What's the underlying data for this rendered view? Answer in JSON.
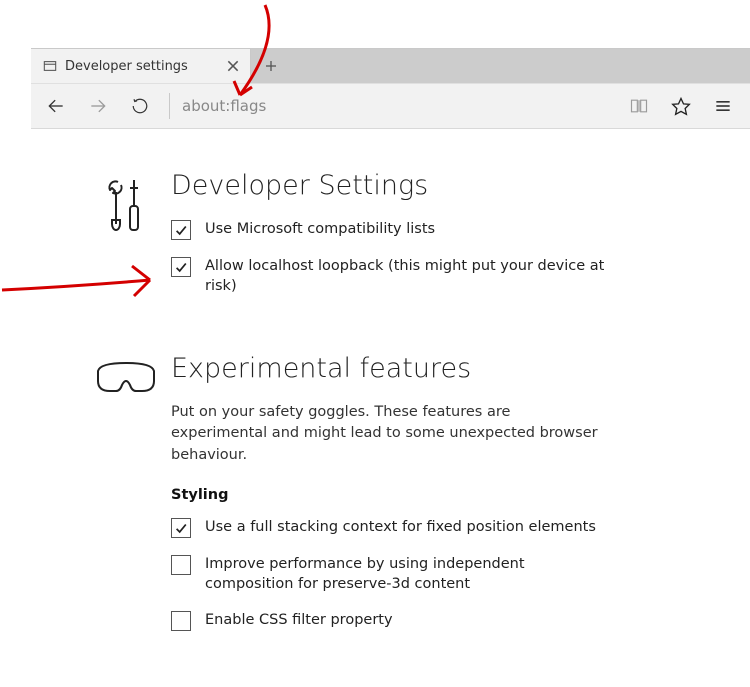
{
  "browser": {
    "tab_title": "Developer settings",
    "address_text": "about:flags"
  },
  "icons": {
    "back": "←",
    "forward": "→",
    "refresh": "↻",
    "reading": "📖",
    "star": "☆",
    "menu": "≡",
    "close": "×",
    "plus": "+"
  },
  "sections": {
    "dev": {
      "title": "Developer Settings",
      "items": [
        {
          "label": "Use Microsoft compatibility lists",
          "checked": true
        },
        {
          "label": "Allow localhost loopback (this might put your device at risk)",
          "checked": true
        }
      ]
    },
    "exp": {
      "title": "Experimental features",
      "description": "Put on your safety goggles. These features are experimental and might lead to some unexpected browser behaviour.",
      "styling_heading": "Styling",
      "styling_items": [
        {
          "label": "Use a full stacking context for fixed position elements",
          "checked": true
        },
        {
          "label": "Improve performance by using independent composition for preserve-3d content",
          "checked": false
        },
        {
          "label": "Enable CSS filter property",
          "checked": false
        }
      ]
    }
  }
}
